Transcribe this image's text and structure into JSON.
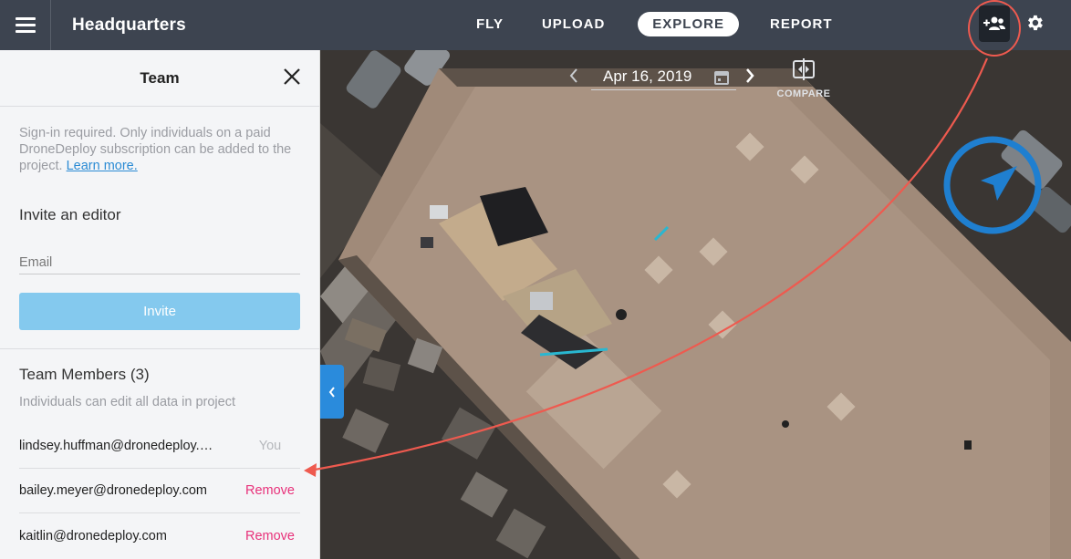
{
  "app": {
    "title": "Headquarters"
  },
  "nav": {
    "items": [
      "FLY",
      "UPLOAD",
      "EXPLORE",
      "REPORT"
    ],
    "active": "EXPLORE"
  },
  "panel": {
    "title": "Team",
    "notice": "Sign-in required. Only individuals on a paid DroneDeploy subscription can be added to the project.",
    "notice_link": "Learn more.",
    "invite_heading": "Invite an editor",
    "email_placeholder": "Email",
    "invite_button": "Invite",
    "members_heading": "Team Members (3)",
    "members_sub": "Individuals can edit all data in project",
    "members": [
      {
        "email": "lindsey.huffman@dronedeploy.com",
        "action": "You"
      },
      {
        "email": "bailey.meyer@dronedeploy.com",
        "action": "Remove"
      },
      {
        "email": "kaitlin@dronedeploy.com",
        "action": "Remove"
      }
    ]
  },
  "map": {
    "date": "Apr 16, 2019",
    "compare_label": "COMPARE"
  },
  "colors": {
    "topbar": "#3d4450",
    "accent_blue": "#2a8bdc",
    "invite_button": "#84c9ee",
    "remove_text": "#e8317a",
    "annotation_red": "#ee5a4f"
  },
  "icons": [
    "menu-icon",
    "add-team-icon",
    "gear-icon",
    "close-icon",
    "chevron-left-icon",
    "calendar-icon",
    "chevron-right-icon",
    "compare-icon",
    "compass-icon"
  ]
}
